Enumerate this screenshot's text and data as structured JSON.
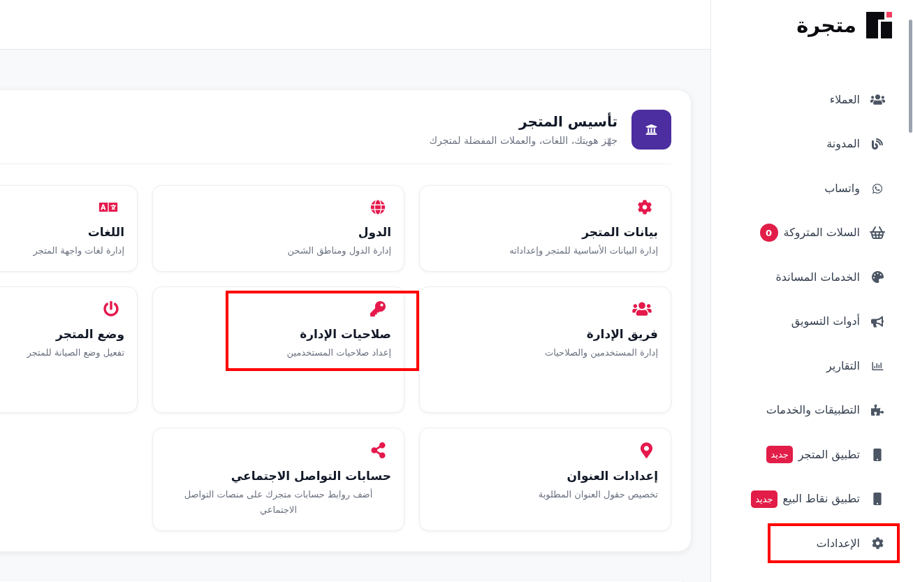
{
  "sidebar": {
    "logo": "متجرة",
    "items": [
      {
        "label": "العملاء",
        "highlighted": false
      },
      {
        "label": "المدونة",
        "highlighted": false
      },
      {
        "label": "واتساب",
        "highlighted": false
      },
      {
        "label": "السلات المتروكة",
        "badge": {
          "kind": "count",
          "text": "0"
        },
        "highlighted": false
      },
      {
        "label": "الخدمات المساندة",
        "highlighted": false
      },
      {
        "label": "أدوات التسويق",
        "highlighted": false
      },
      {
        "label": "التقارير",
        "highlighted": false
      },
      {
        "label": "التطبيقات والخدمات",
        "highlighted": false
      },
      {
        "label": "تطبيق المتجر",
        "badge": {
          "kind": "new",
          "text": "جديد"
        },
        "highlighted": false
      },
      {
        "label": "تطبيق نقاط البيع",
        "badge": {
          "kind": "new",
          "text": "جديد"
        },
        "highlighted": false
      },
      {
        "label": "الإعدادات",
        "highlighted": true
      }
    ]
  },
  "store_setup": {
    "title": "تأسيس المتجر",
    "subtitle": "جهّز هويتك، اللغات، والعملات المفضلة لمتجرك",
    "cards": [
      {
        "title": "بيانات المتجر",
        "description": "إدارة البيانات الأساسية للمتجر وإعداداته",
        "highlighted": false
      },
      {
        "title": "الدول",
        "description": "إدارة الدول ومناطق الشحن",
        "highlighted": false
      },
      {
        "title": "اللغات",
        "description": "إدارة لغات واجهة المتجر",
        "highlighted": false
      },
      {
        "title": "فريق الإدارة",
        "description": "إدارة المستخدمين والصلاحيات",
        "highlighted": false
      },
      {
        "title": "صلاحيات الإدارة",
        "description": "إعداد صلاحيات المستخدمين",
        "highlighted": true
      },
      {
        "title": "وضع المتجر",
        "description": "تفعيل وضع الصيانة للمتجر",
        "highlighted": false
      },
      {
        "title": "إعدادات العنوان",
        "description": "تخصيص حقول العنوان المطلوبة",
        "highlighted": false
      },
      {
        "title": "حسابات التواصل الاجتماعي",
        "description": "أضف روابط حسابات متجرك على منصات التواصل الاجتماعي",
        "highlighted": false
      }
    ]
  }
}
